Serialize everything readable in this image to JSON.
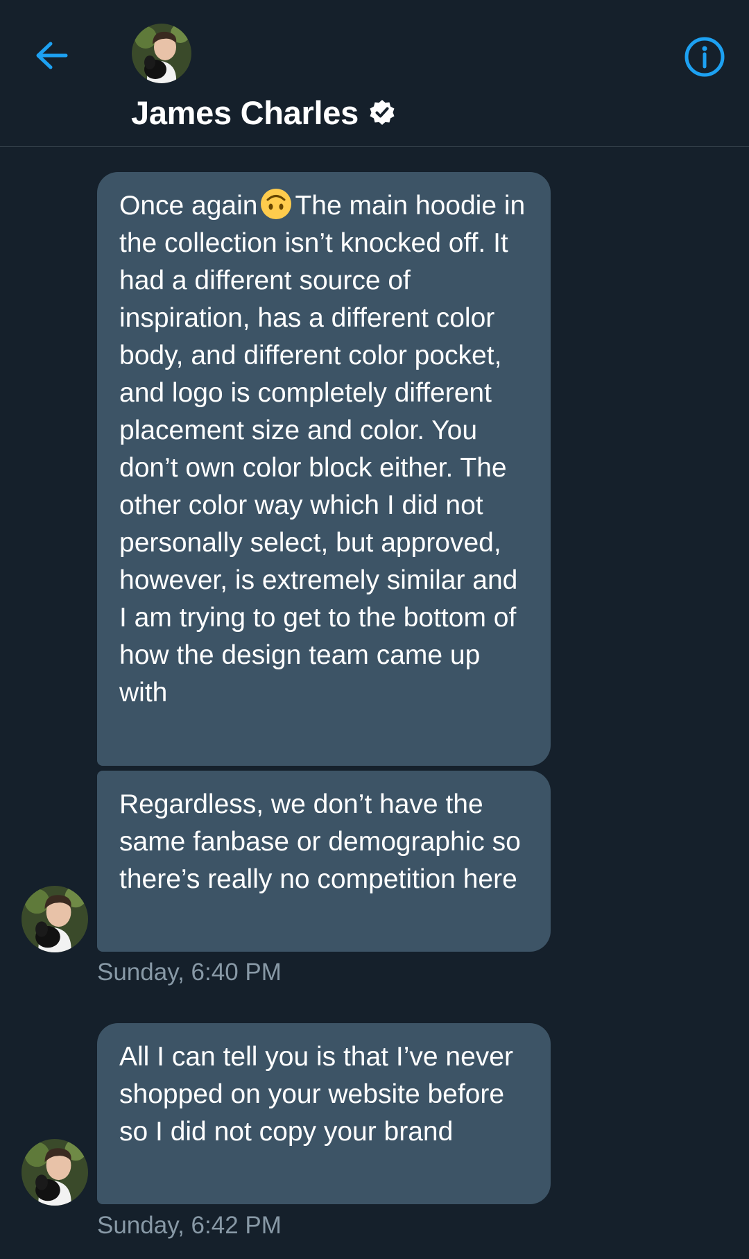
{
  "header": {
    "contact_name": "James Charles",
    "back_icon": "back-arrow-icon",
    "info_icon": "info-icon",
    "verified_icon": "verified-badge-icon",
    "accent_color": "#1da1f2"
  },
  "messages": [
    {
      "text_before_emoji": "Once again",
      "emoji": "upside-down-face-emoji",
      "text_after_emoji": "The main hoodie in the collection isn’t knocked off. It had a different source of inspiration, has a different color body, and different color pocket, and logo is completely different placement size and color. You don’t own color block either. The other color way which I did not personally select, but approved, however, is extremely similar and I am trying to get to the bottom of how the design team came up with"
    },
    {
      "text": "Regardless, we don’t have the same fanbase or demographic so there’s really no competition here",
      "timestamp": "Sunday, 6:40 PM"
    },
    {
      "text": "All I can tell you is that I’ve never shopped on your website before so I did not copy your brand",
      "timestamp": "Sunday, 6:42 PM"
    }
  ],
  "colors": {
    "background": "#15202b",
    "bubble": "#3d5466",
    "timestamp": "#8899a6",
    "divider": "#38444d"
  }
}
